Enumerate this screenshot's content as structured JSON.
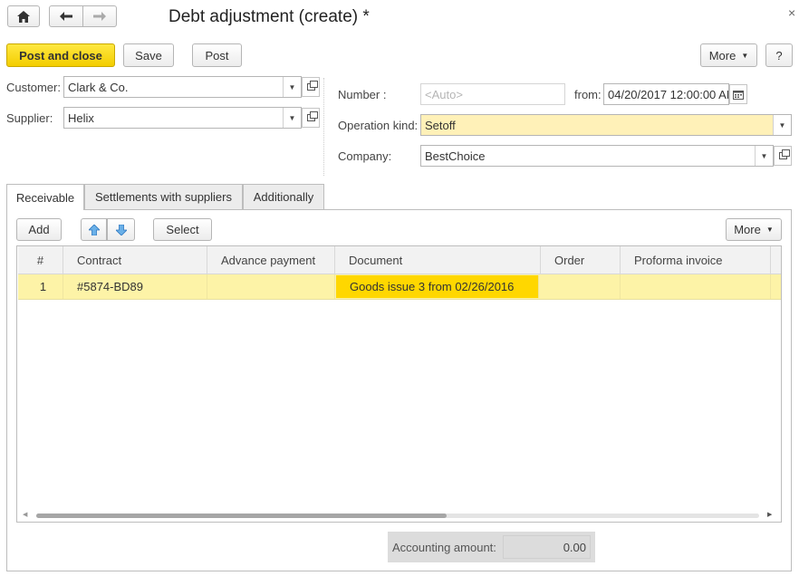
{
  "window": {
    "title": "Debt adjustment (create) *",
    "close_glyph": "×"
  },
  "toolbar": {
    "post_and_close": "Post and close",
    "save": "Save",
    "post": "Post",
    "more": "More",
    "help": "?"
  },
  "header": {
    "customer_label": "Customer:",
    "customer_value": "Clark & Co.",
    "supplier_label": "Supplier:",
    "supplier_value": "Helix",
    "number_label": "Number :",
    "number_placeholder": "<Auto>",
    "from_label": "from:",
    "from_value": "04/20/2017 12:00:00 AM",
    "operation_kind_label": "Operation kind:",
    "operation_kind_value": "Setoff",
    "company_label": "Company:",
    "company_value": "BestChoice"
  },
  "tabs": [
    {
      "label": "Receivable"
    },
    {
      "label": "Settlements with suppliers"
    },
    {
      "label": "Additionally"
    }
  ],
  "table_toolbar": {
    "add": "Add",
    "select": "Select",
    "more": "More"
  },
  "table": {
    "columns": [
      "#",
      "Contract",
      "Advance payment",
      "Document",
      "Order",
      "Proforma invoice"
    ],
    "rows": [
      {
        "num": "1",
        "contract": "#5874-BD89",
        "advance_payment": "",
        "document": "Goods issue 3 from 02/26/2016",
        "order": "",
        "proforma_invoice": ""
      }
    ]
  },
  "footer": {
    "accounting_amount_label": "Accounting amount:",
    "accounting_amount_value": "0.00"
  },
  "colors": {
    "primary_yellow": "#f5d000",
    "row_highlight": "#fdf3a7",
    "selected_cell": "#ffd700",
    "field_highlight": "#fff1b8"
  }
}
